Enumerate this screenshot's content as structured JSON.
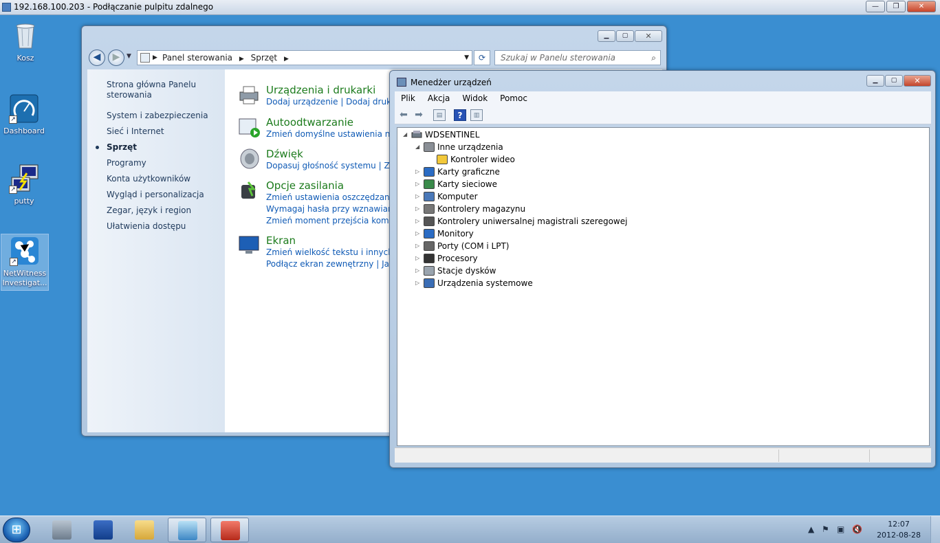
{
  "rdp": {
    "title": "192.168.100.203 - Podłączanie pulpitu zdalnego"
  },
  "desktop": {
    "icons": [
      {
        "label": "Kosz"
      },
      {
        "label": "Dashboard"
      },
      {
        "label": "putty"
      },
      {
        "label": "NetWitness Investigat..."
      }
    ]
  },
  "control_panel": {
    "breadcrumb": [
      "Panel sterowania",
      "Sprzęt"
    ],
    "search_placeholder": "Szukaj w Panelu sterowania",
    "sidebar": [
      "Strona główna Panelu sterowania",
      "System i zabezpieczenia",
      "Sieć i Internet",
      "Sprzęt",
      "Programy",
      "Konta użytkowników",
      "Wygląd i personalizacja",
      "Zegar, język i region",
      "Ułatwienia dostępu"
    ],
    "categories": [
      {
        "title": "Urządzenia i drukarki",
        "links": [
          "Dodaj urządzenie | Dodaj drukarkę"
        ]
      },
      {
        "title": "Autoodtwarzanie",
        "links": [
          "Zmień domyślne ustawienia nośni"
        ]
      },
      {
        "title": "Dźwięk",
        "links": [
          "Dopasuj głośność systemu | Zm"
        ]
      },
      {
        "title": "Opcje zasilania",
        "links": [
          "Zmień ustawienia oszczędzania en",
          "Wymagaj hasła przy wznawianiu p",
          "Zmień moment przejścia komput"
        ]
      },
      {
        "title": "Ekran",
        "links": [
          "Zmień wielkość tekstu i innych ele",
          "Podłącz ekran zewnętrzny | Jak s"
        ]
      }
    ]
  },
  "device_manager": {
    "title": "Menedżer urządzeń",
    "menu": [
      "Plik",
      "Akcja",
      "Widok",
      "Pomoc"
    ],
    "root": "WDSENTINEL",
    "tree": [
      {
        "label": "Inne urządzenia",
        "level": 1,
        "expanded": true
      },
      {
        "label": "Kontroler wideo",
        "level": 2,
        "expanded": false
      },
      {
        "label": "Karty graficzne",
        "level": 1,
        "expanded": false
      },
      {
        "label": "Karty sieciowe",
        "level": 1,
        "expanded": false
      },
      {
        "label": "Komputer",
        "level": 1,
        "expanded": false
      },
      {
        "label": "Kontrolery magazynu",
        "level": 1,
        "expanded": false
      },
      {
        "label": "Kontrolery uniwersalnej magistrali szeregowej",
        "level": 1,
        "expanded": false
      },
      {
        "label": "Monitory",
        "level": 1,
        "expanded": false
      },
      {
        "label": "Porty (COM i LPT)",
        "level": 1,
        "expanded": false
      },
      {
        "label": "Procesory",
        "level": 1,
        "expanded": false
      },
      {
        "label": "Stacje dysków",
        "level": 1,
        "expanded": false
      },
      {
        "label": "Urządzenia systemowe",
        "level": 1,
        "expanded": false
      }
    ]
  },
  "taskbar": {
    "time": "12:07",
    "date": "2012-08-28"
  },
  "colors": {
    "desktop": "#3a8ed1",
    "link": "#0f5ab5",
    "category_title": "#1c7b1c"
  }
}
